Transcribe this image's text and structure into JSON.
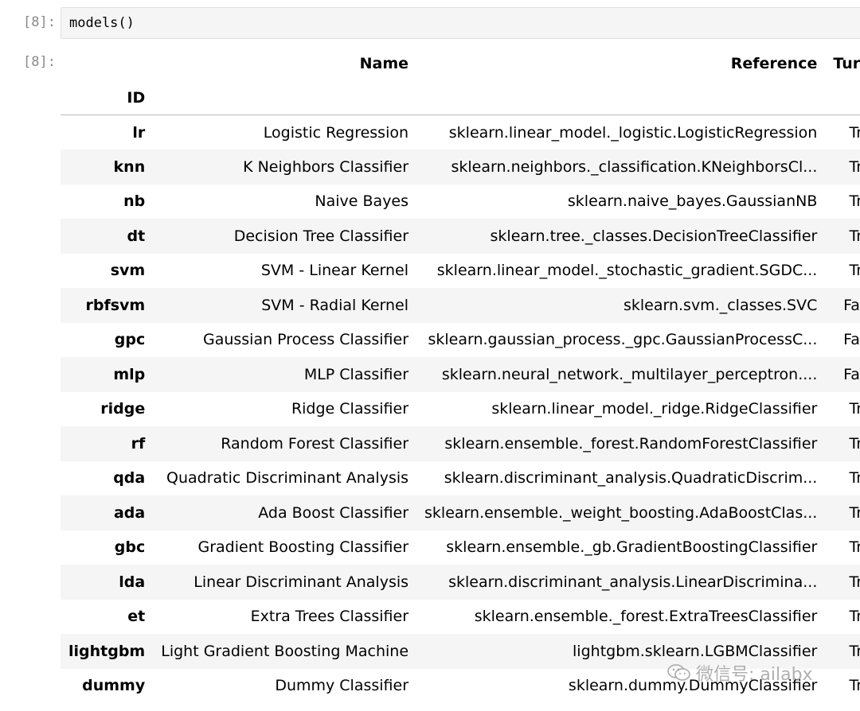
{
  "input_cell": {
    "prompt": "[8]:",
    "code": "models()"
  },
  "output_cell": {
    "prompt": "[8]:",
    "table": {
      "columns": [
        "Name",
        "Reference",
        "Turbo"
      ],
      "index_name": "ID",
      "rows": [
        {
          "id": "lr",
          "name": "Logistic Regression",
          "reference": "sklearn.linear_model._logistic.LogisticRegression",
          "turbo": "True"
        },
        {
          "id": "knn",
          "name": "K Neighbors Classifier",
          "reference": "sklearn.neighbors._classification.KNeighborsCl...",
          "turbo": "True"
        },
        {
          "id": "nb",
          "name": "Naive Bayes",
          "reference": "sklearn.naive_bayes.GaussianNB",
          "turbo": "True"
        },
        {
          "id": "dt",
          "name": "Decision Tree Classifier",
          "reference": "sklearn.tree._classes.DecisionTreeClassifier",
          "turbo": "True"
        },
        {
          "id": "svm",
          "name": "SVM - Linear Kernel",
          "reference": "sklearn.linear_model._stochastic_gradient.SGDC...",
          "turbo": "True"
        },
        {
          "id": "rbfsvm",
          "name": "SVM - Radial Kernel",
          "reference": "sklearn.svm._classes.SVC",
          "turbo": "False"
        },
        {
          "id": "gpc",
          "name": "Gaussian Process Classifier",
          "reference": "sklearn.gaussian_process._gpc.GaussianProcessC...",
          "turbo": "False"
        },
        {
          "id": "mlp",
          "name": "MLP Classifier",
          "reference": "sklearn.neural_network._multilayer_perceptron....",
          "turbo": "False"
        },
        {
          "id": "ridge",
          "name": "Ridge Classifier",
          "reference": "sklearn.linear_model._ridge.RidgeClassifier",
          "turbo": "True"
        },
        {
          "id": "rf",
          "name": "Random Forest Classifier",
          "reference": "sklearn.ensemble._forest.RandomForestClassifier",
          "turbo": "True"
        },
        {
          "id": "qda",
          "name": "Quadratic Discriminant Analysis",
          "reference": "sklearn.discriminant_analysis.QuadraticDiscrim...",
          "turbo": "True"
        },
        {
          "id": "ada",
          "name": "Ada Boost Classifier",
          "reference": "sklearn.ensemble._weight_boosting.AdaBoostClas...",
          "turbo": "True"
        },
        {
          "id": "gbc",
          "name": "Gradient Boosting Classifier",
          "reference": "sklearn.ensemble._gb.GradientBoostingClassifier",
          "turbo": "True"
        },
        {
          "id": "lda",
          "name": "Linear Discriminant Analysis",
          "reference": "sklearn.discriminant_analysis.LinearDiscrimina...",
          "turbo": "True"
        },
        {
          "id": "et",
          "name": "Extra Trees Classifier",
          "reference": "sklearn.ensemble._forest.ExtraTreesClassifier",
          "turbo": "True"
        },
        {
          "id": "lightgbm",
          "name": "Light Gradient Boosting Machine",
          "reference": "lightgbm.sklearn.LGBMClassifier",
          "turbo": "True"
        },
        {
          "id": "dummy",
          "name": "Dummy Classifier",
          "reference": "sklearn.dummy.DummyClassifier",
          "turbo": "True"
        }
      ]
    }
  },
  "watermark": {
    "icon": "wechat-icon",
    "text": "微信号: ailabx"
  },
  "colors": {
    "prompt": "#8a8a8a",
    "input_bg": "#f5f5f5",
    "zebra": "#f5f5f5"
  }
}
